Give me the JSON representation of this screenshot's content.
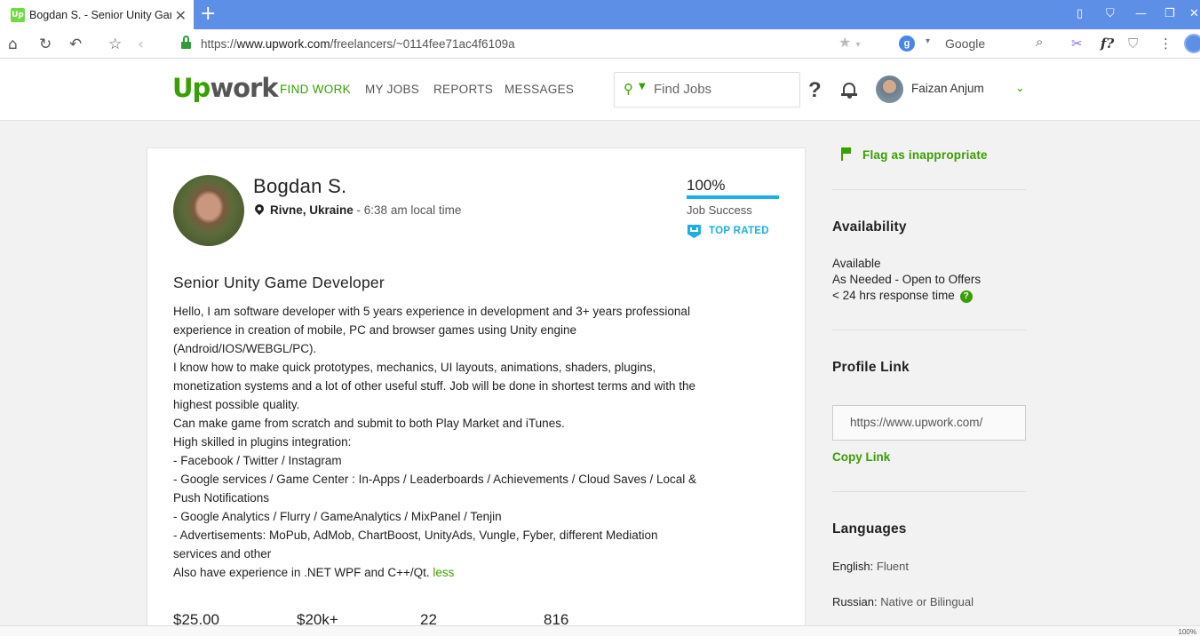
{
  "browser": {
    "tab_title": "Bogdan S. - Senior Unity Game",
    "favicon_text": "Up",
    "url_prefix": "https://",
    "url_domain": "www.upwork.com",
    "url_path": "/freelancers/~0114fee71ac4f6109a",
    "search_engine_label": "Google",
    "status_zoom": "100%"
  },
  "header": {
    "logo_a": "Up",
    "logo_b": "work",
    "nav": [
      "FIND WORK",
      "MY JOBS",
      "REPORTS",
      "MESSAGES"
    ],
    "search_placeholder": "Find Jobs",
    "help_label": "?",
    "user_name": "Faizan Anjum"
  },
  "profile": {
    "name": "Bogdan S.",
    "location": "Rivne, Ukraine",
    "local_time": " - 6:38 am local time",
    "job_success_value": "100%",
    "job_success_fraction": 1.0,
    "job_success_label": "Job Success",
    "badge_label": "TOP RATED",
    "title": "Senior Unity Game Developer",
    "overview_lines": [
      "Hello, I am software developer with 5 years experience in development and 3+ years professional",
      "experience in creation of mobile, PC and browser games using Unity engine",
      "(Android/IOS/WEBGL/PC).",
      "I know how to make quick prototypes, mechanics, UI layouts, animations, shaders, plugins,",
      "monetization systems and a lot of other useful stuff. Job will be done in shortest terms and with the",
      "highest possible quality.",
      "Can make game from scratch and submit to both Play Market and iTunes.",
      "High skilled in plugins integration:",
      "- Facebook / Twitter / Instagram",
      "- Google services / Game Center : In-Apps / Leaderboards / Achievements / Cloud Saves / Local &",
      "Push Notifications",
      "- Google Analytics / Flurry / GameAnalytics / MixPanel / Tenjin",
      "- Advertisements: MoPub, AdMob, ChartBoost, UnityAds, Vungle, Fyber, different Mediation",
      "services and other",
      "Also have experience in .NET WPF and C++/Qt."
    ],
    "less_label": "less",
    "stats": [
      "$25.00",
      "$20k+",
      "22",
      "816"
    ]
  },
  "sidebar": {
    "flag_label": "Flag as inappropriate",
    "availability_heading": "Availability",
    "availability_status": "Available",
    "availability_hours": "As Needed - Open to Offers",
    "response_time": "< 24 hrs response time",
    "response_help": "?",
    "profile_link_heading": "Profile Link",
    "profile_link_value": "https://www.upwork.com/",
    "copy_link_label": "Copy Link",
    "languages_heading": "Languages",
    "languages": [
      {
        "name": "English:",
        "level": "Fluent"
      },
      {
        "name": "Russian:",
        "level": "Native or Bilingual"
      }
    ]
  }
}
